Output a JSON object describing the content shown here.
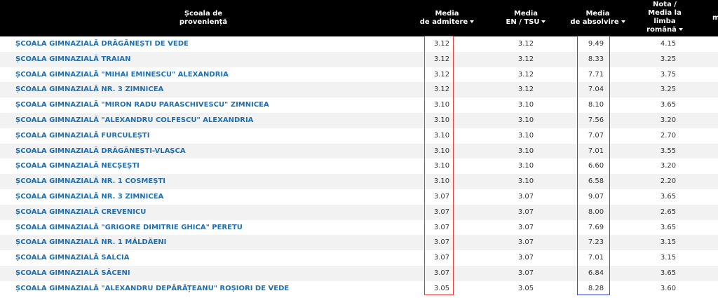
{
  "header": {
    "school_line1": "Școala de",
    "school_line2": "proveniență",
    "admitere_line1": "Media",
    "admitere_line2": "de admitere",
    "en_line1": "Media",
    "en_line2": "EN / TSU",
    "absolvire_line1": "Media",
    "absolvire_line2": "de absolvire",
    "romana_line1": "Nota /",
    "romana_line2": "Media la",
    "romana_line3": "limba",
    "romana_line4": "română",
    "cut_text": "m"
  },
  "rows": [
    {
      "school": "ȘCOALA GIMNAZIALĂ DRĂGĂNEȘTI DE VEDE",
      "admitere": "3.12",
      "en": "3.12",
      "absolvire": "9.49",
      "romana": "4.15"
    },
    {
      "school": "ȘCOALA GIMNAZIALĂ TRAIAN",
      "admitere": "3.12",
      "en": "3.12",
      "absolvire": "8.33",
      "romana": "3.25"
    },
    {
      "school": "ȘCOALA GIMNAZIALĂ \"MIHAI EMINESCU\" ALEXANDRIA",
      "admitere": "3.12",
      "en": "3.12",
      "absolvire": "7.71",
      "romana": "3.75"
    },
    {
      "school": "ȘCOALA GIMNAZIALĂ NR. 3 ZIMNICEA",
      "admitere": "3.12",
      "en": "3.12",
      "absolvire": "7.04",
      "romana": "3.25"
    },
    {
      "school": "ȘCOALA GIMNAZIALĂ \"MIRON RADU PARASCHIVESCU\" ZIMNICEA",
      "admitere": "3.10",
      "en": "3.10",
      "absolvire": "8.10",
      "romana": "3.65"
    },
    {
      "school": "ȘCOALA GIMNAZIALĂ \"ALEXANDRU COLFESCU\" ALEXANDRIA",
      "admitere": "3.10",
      "en": "3.10",
      "absolvire": "7.56",
      "romana": "3.20"
    },
    {
      "school": "ȘCOALA GIMNAZIALĂ FURCULEȘTI",
      "admitere": "3.10",
      "en": "3.10",
      "absolvire": "7.07",
      "romana": "2.70"
    },
    {
      "school": "ȘCOALA GIMNAZIALĂ DRĂGĂNEȘTI-VLAȘCA",
      "admitere": "3.10",
      "en": "3.10",
      "absolvire": "7.01",
      "romana": "3.55"
    },
    {
      "school": "ȘCOALA GIMNAZIALĂ NECȘEȘTI",
      "admitere": "3.10",
      "en": "3.10",
      "absolvire": "6.60",
      "romana": "3.20"
    },
    {
      "school": "ȘCOALA GIMNAZIALĂ NR. 1 COSMEȘTI",
      "admitere": "3.10",
      "en": "3.10",
      "absolvire": "6.58",
      "romana": "2.20"
    },
    {
      "school": "ȘCOALA GIMNAZIALĂ NR. 3 ZIMNICEA",
      "admitere": "3.07",
      "en": "3.07",
      "absolvire": "9.07",
      "romana": "3.65"
    },
    {
      "school": "ȘCOALA GIMNAZIALĂ CREVENICU",
      "admitere": "3.07",
      "en": "3.07",
      "absolvire": "8.00",
      "romana": "2.65"
    },
    {
      "school": "ȘCOALA GIMNAZIALĂ \"GRIGORE DIMITRIE GHICA\" PERETU",
      "admitere": "3.07",
      "en": "3.07",
      "absolvire": "7.69",
      "romana": "3.65"
    },
    {
      "school": "ȘCOALA GIMNAZIALĂ NR. 1 MĂLDĂENI",
      "admitere": "3.07",
      "en": "3.07",
      "absolvire": "7.23",
      "romana": "3.15"
    },
    {
      "school": "ȘCOALA GIMNAZIALĂ SALCIA",
      "admitere": "3.07",
      "en": "3.07",
      "absolvire": "7.01",
      "romana": "3.15"
    },
    {
      "school": "ȘCOALA GIMNAZIALĂ SĂCENI",
      "admitere": "3.07",
      "en": "3.07",
      "absolvire": "6.84",
      "romana": "3.65"
    },
    {
      "school": "ȘCOALA GIMNAZIALĂ \"ALEXANDRU DEPĂRĂȚEANU\" ROȘIORI DE VEDE",
      "admitere": "3.05",
      "en": "3.05",
      "absolvire": "8.28",
      "romana": "3.60"
    }
  ],
  "colors": {
    "header_bg": "#000000",
    "link": "#1f6fb5",
    "highlight_admitere": "#e03a3a",
    "highlight_absolvire": "#3a4fe0",
    "row_alt": "#f2f2f2"
  },
  "icons": {
    "sort": "sort-caret-down-icon"
  }
}
